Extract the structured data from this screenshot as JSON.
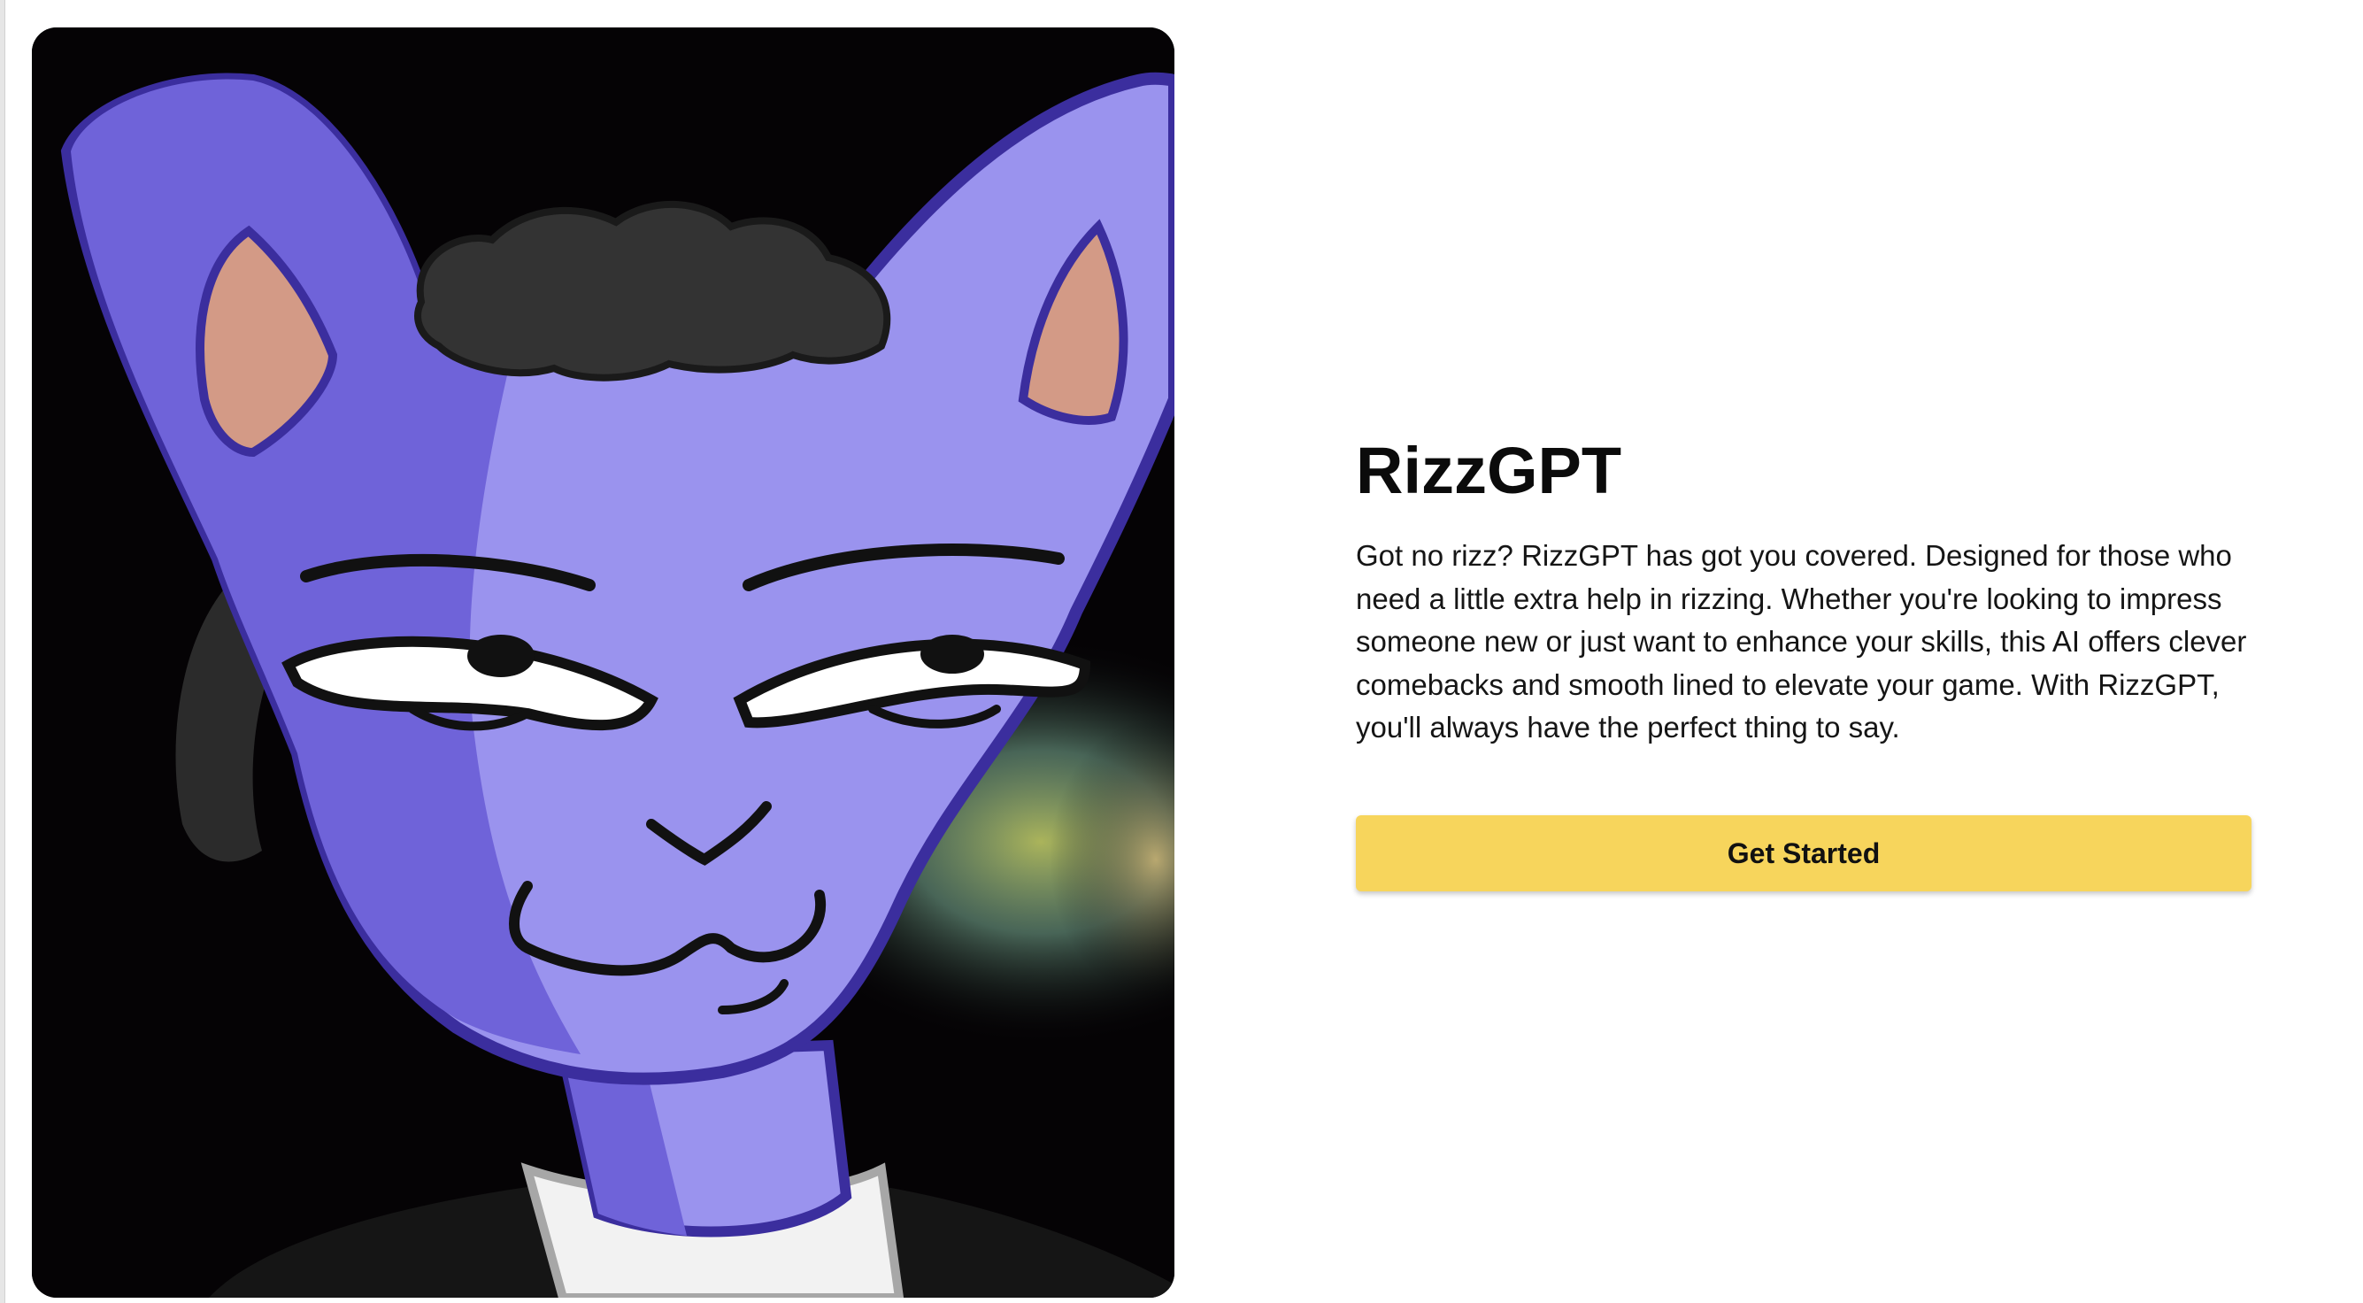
{
  "hero": {
    "image_alt": "Purple cartoon cat with a smug grin",
    "ear_color": "#9a93ee",
    "outline_color": "#3b2e9e",
    "inner_ear_color": "#d39a86",
    "background_color": "#050305"
  },
  "app": {
    "title": "RizzGPT",
    "description": "Got no rizz? RizzGPT has got you covered. Designed for those who need a little extra help in rizzing. Whether you're looking to impress someone new or just want to enhance your skills, this AI offers clever comebacks and smooth lined to elevate your game. With RizzGPT, you'll always have the perfect thing to say.",
    "cta_label": "Get Started",
    "accent_color": "#f7d55c"
  }
}
